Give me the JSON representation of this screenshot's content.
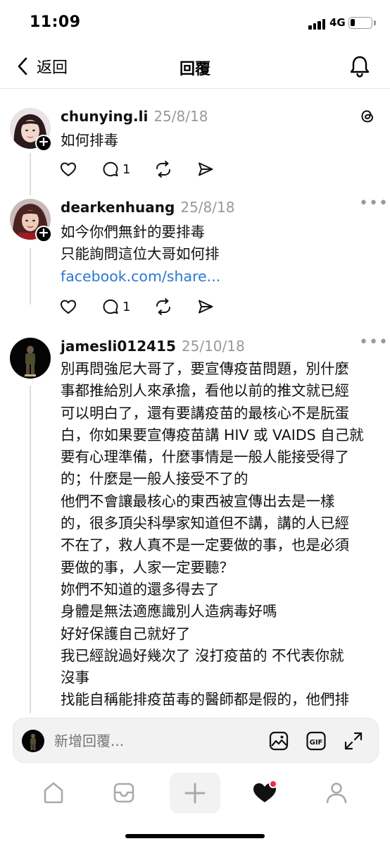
{
  "status_bar": {
    "time": "11:09",
    "network": "4G"
  },
  "header": {
    "back_label": "返回",
    "title": "回覆"
  },
  "posts": [
    {
      "username": "chunying.li",
      "date": "25/8/18",
      "lines": [
        "如何排毒"
      ],
      "reply_count": "1"
    },
    {
      "username": "dearkenhuang",
      "date": "25/8/18",
      "lines": [
        "如今你們無針的要排毒",
        "只能詢問這位大哥如何排"
      ],
      "link": "facebook.com/share...",
      "reply_count": "1"
    },
    {
      "username": "jamesli012415",
      "date": "25/10/18",
      "lines": [
        "別再問強尼大哥了，要宣傳疫苗問題，別什麼",
        "事都推給別人來承擔，看他以前的推文就已經",
        "可以明白了，還有要講疫苗的最核心不是朊蛋",
        "白，你如果要宣傳疫苗講 HIV 或 VAIDS 自己就",
        "要有心理準備，什麼事情是一般人能接受得了",
        "的；什麼是一般人接受不了的",
        "他們不會讓最核心的東西被宣傳出去是一樣",
        "的，很多頂尖科學家知道但不講，講的人已經",
        "不在了，救人真不是一定要做的事，也是必須",
        "要做的事，人家一定要聽？",
        "妳們不知道的還多得去了",
        "身體是無法適應識別人造病毒好嗎",
        "好好保護自己就好了",
        "我已經說過好幾次了 沒打疫苗的 不代表你就",
        "沒事",
        "找能自稱能排疫苗毒的醫師都是假的，他們排"
      ]
    }
  ],
  "reply_bar": {
    "placeholder": "新增回覆..."
  },
  "colors": {
    "link": "#2a78d2",
    "notification_dot": "#e8304a"
  }
}
